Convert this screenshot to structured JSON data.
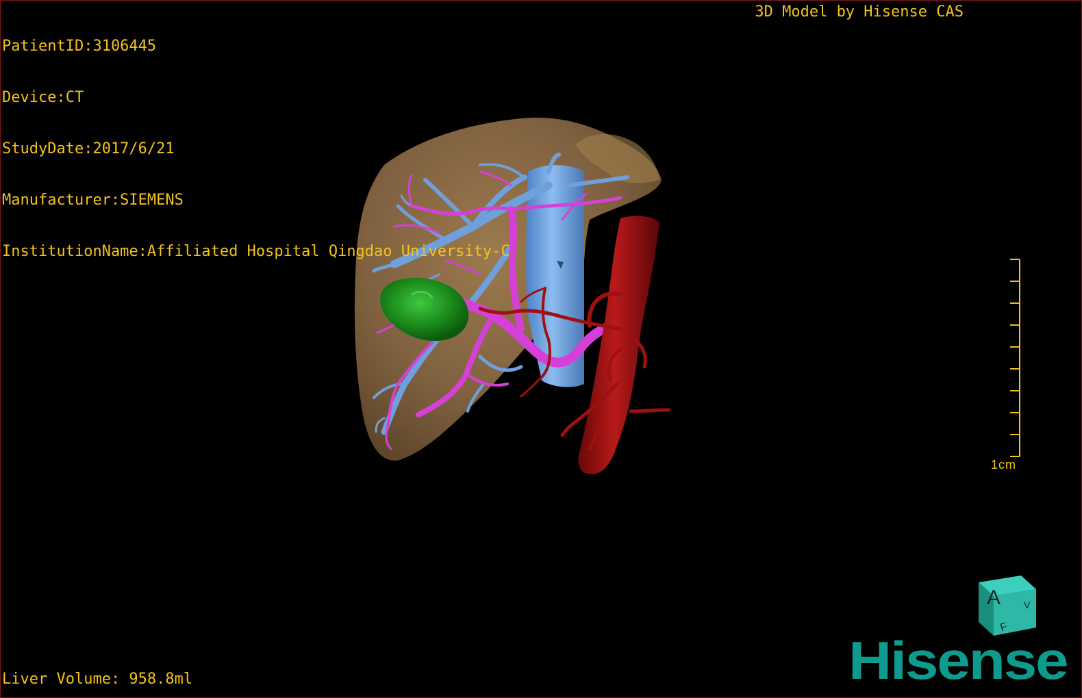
{
  "patient_info": [
    {
      "label": "PatientID:3106445"
    },
    {
      "label": "Device:CT"
    },
    {
      "label": "StudyDate:2017/6/21"
    },
    {
      "label": "Manufacturer:SIEMENS"
    },
    {
      "label": "InstitutionName:Affiliated Hospital Qingdao University-C"
    }
  ],
  "model_credit": "3D Model by Hisense CAS",
  "liver_volume": "Liver Volume: 958.8ml",
  "scale_bar": {
    "label": "1cm"
  },
  "orientation_cube": {
    "front_label": "A",
    "side_label": "V",
    "bottom_label": "F"
  },
  "brand_logo": "Hisense",
  "colors": {
    "overlay_text": "#f4c21a",
    "liver": "#8a6a42",
    "hepatic_vein": "#6fa0dc",
    "portal_vein": "#d640d8",
    "artery": "#a01010",
    "tumor": "#1d9a1d",
    "logo": "#0e9a8c"
  },
  "icons": [
    "orientation-cube-icon",
    "scale-bar-icon",
    "hisense-logo"
  ]
}
